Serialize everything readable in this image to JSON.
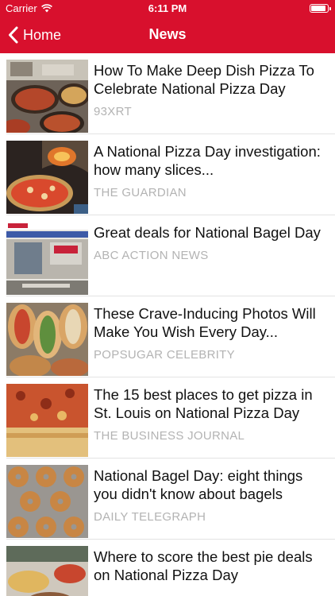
{
  "status_bar": {
    "carrier": "Carrier",
    "time": "6:11 PM"
  },
  "nav": {
    "back_label": "Home",
    "title": "News"
  },
  "articles": [
    {
      "headline": "How To Make Deep Dish Pizza To Celebrate National Pizza Day",
      "source": "93XRT",
      "thumb": "deep-dish-pizza"
    },
    {
      "headline": "A National Pizza Day investigation: how many slices...",
      "source": "THE GUARDIAN",
      "thumb": "pizza-oven"
    },
    {
      "headline": "Great deals for National Bagel Day",
      "source": "ABC ACTION NEWS",
      "thumb": "bagel-storefront"
    },
    {
      "headline": "These Crave-Inducing Photos Will Make You Wish Every Day...",
      "source": "POPSUGAR CELEBRITY",
      "thumb": "bagel-sandwiches"
    },
    {
      "headline": "The 15 best places to get pizza in St. Louis on National Pizza Day",
      "source": "THE BUSINESS JOURNAL",
      "thumb": "pizza-slice"
    },
    {
      "headline": "National Bagel Day: eight things you didn't know about bagels",
      "source": "DAILY TELEGRAPH",
      "thumb": "bagels-rack"
    },
    {
      "headline": "Where to score the best pie deals on National Pizza Day",
      "source": "",
      "thumb": "pie-deals"
    }
  ]
}
